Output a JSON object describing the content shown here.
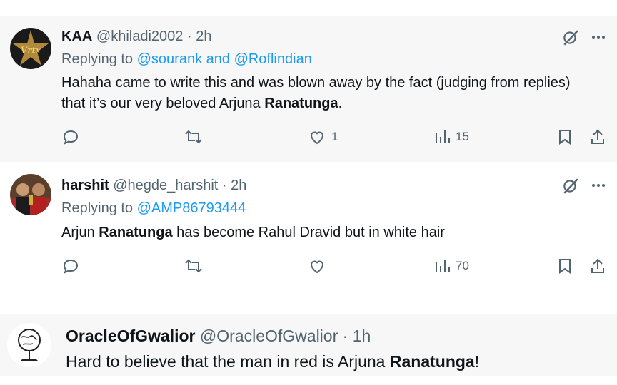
{
  "tweets": [
    {
      "name": "KAA",
      "handle": "@khiladi2002",
      "dot": "·",
      "time": "2h",
      "reply_prefix": "Replying to",
      "reply_targets": "@sourank and @Roflindian",
      "text_before": "Hahaha came to write this and was blown away by the fact (judging from replies) that it’s our very beloved Arjuna",
      "text_bold": "Ranatunga",
      "text_after": ".",
      "likes": "1",
      "views": "15"
    },
    {
      "name": "harshit",
      "handle": "@hegde_harshit",
      "dot": "·",
      "time": "2h",
      "reply_prefix": "Replying to",
      "reply_targets": "@AMP86793444",
      "text_before": "Arjun",
      "text_bold": "Ranatunga",
      "text_after": "has become Rahul Dravid but in white hair",
      "likes": "",
      "views": "70"
    },
    {
      "name": "OracleOfGwalior",
      "handle": "@OracleOfGwalior",
      "dot": "·",
      "time": "1h",
      "text_before": "Hard to believe that the man in red is Arjuna",
      "text_bold": "Ranatunga",
      "text_after": "!"
    }
  ],
  "icons": {
    "reply": "reply-icon",
    "retweet": "retweet-icon",
    "like": "heart-icon",
    "views": "views-icon",
    "bookmark": "bookmark-icon",
    "share": "share-icon",
    "grok": "grok-icon",
    "more": "more-icon"
  },
  "colors": {
    "link": "#1d9bf0",
    "muted": "#536471",
    "text": "#0f1419",
    "highlight_bg": "#f7f7f8"
  }
}
